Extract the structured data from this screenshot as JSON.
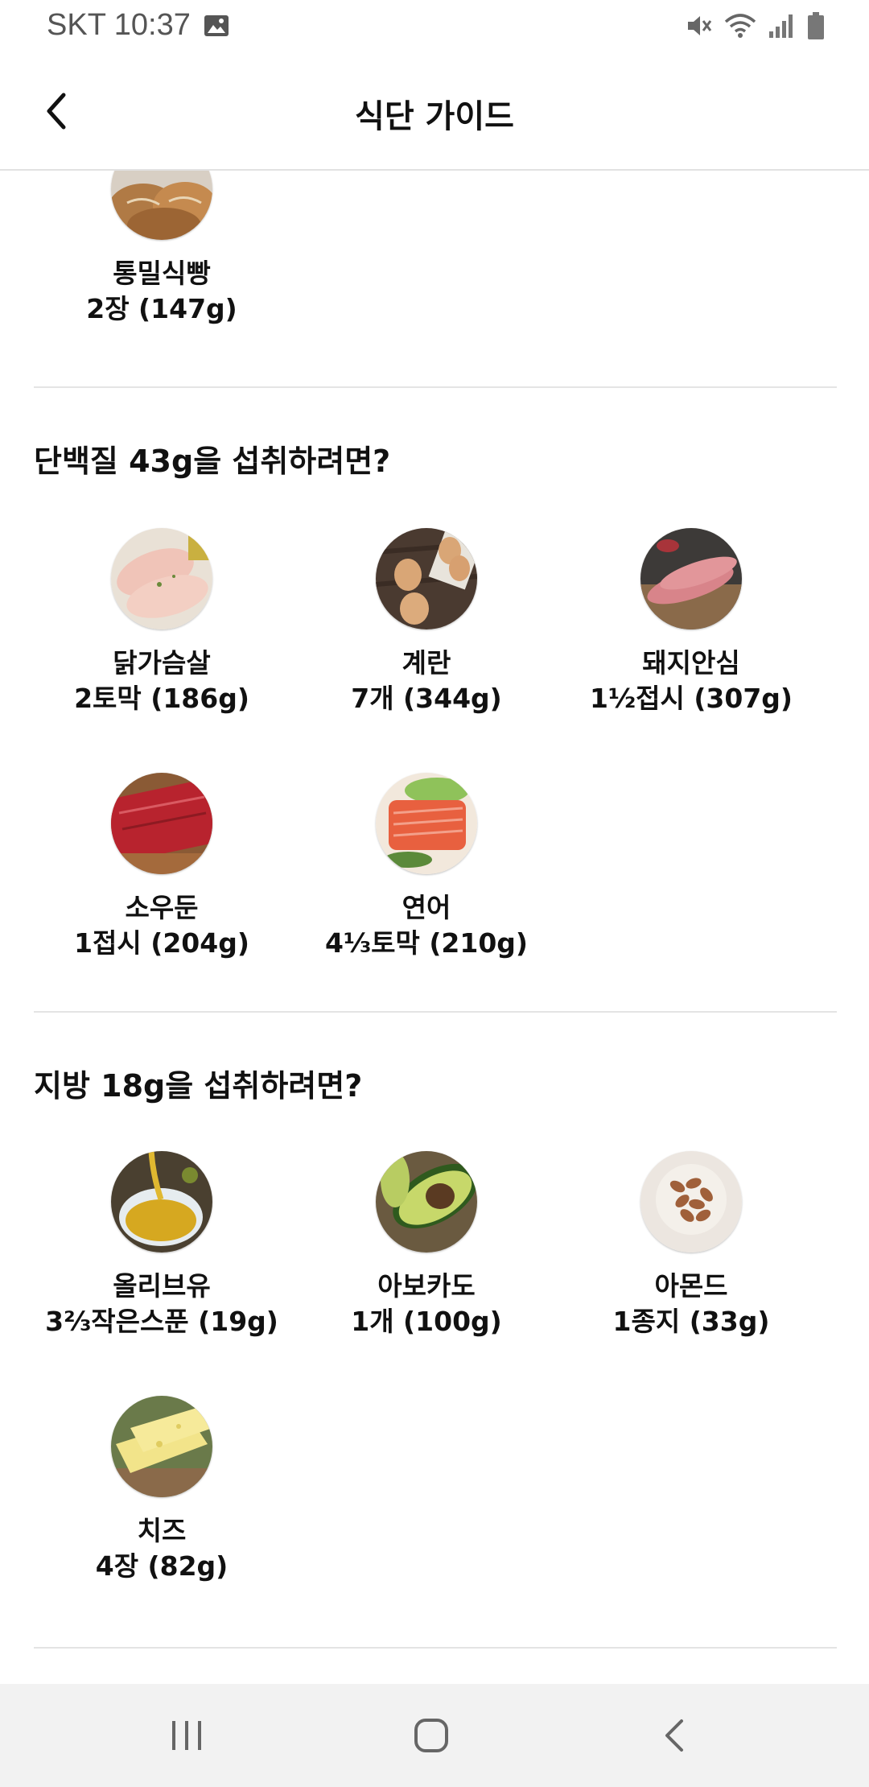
{
  "status_bar": {
    "carrier_time": "SKT 10:37"
  },
  "header": {
    "title": "식단 가이드"
  },
  "sections": [
    {
      "title": "",
      "foods": [
        {
          "name": "통밀식빵",
          "amount": "2장 (147g)",
          "icon": "bread-image"
        }
      ]
    },
    {
      "title": "단백질 43g을 섭취하려면?",
      "foods": [
        {
          "name": "닭가슴살",
          "amount": "2토막 (186g)",
          "icon": "chicken-breast-image"
        },
        {
          "name": "계란",
          "amount": "7개 (344g)",
          "icon": "egg-image"
        },
        {
          "name": "돼지안심",
          "amount": "1½접시 (307g)",
          "icon": "pork-tenderloin-image"
        },
        {
          "name": "소우둔",
          "amount": "1접시 (204g)",
          "icon": "beef-image"
        },
        {
          "name": "연어",
          "amount": "4⅓토막 (210g)",
          "icon": "salmon-image"
        }
      ]
    },
    {
      "title": "지방 18g을 섭취하려면?",
      "foods": [
        {
          "name": "올리브유",
          "amount": "3⅔작은스푼 (19g)",
          "icon": "olive-oil-image"
        },
        {
          "name": "아보카도",
          "amount": "1개 (100g)",
          "icon": "avocado-image"
        },
        {
          "name": "아몬드",
          "amount": "1종지 (33g)",
          "icon": "almond-image"
        },
        {
          "name": "치즈",
          "amount": "4장 (82g)",
          "icon": "cheese-image"
        }
      ]
    }
  ],
  "nav": {
    "recent": "recent-apps-icon",
    "home": "home-icon",
    "back": "back-icon"
  }
}
